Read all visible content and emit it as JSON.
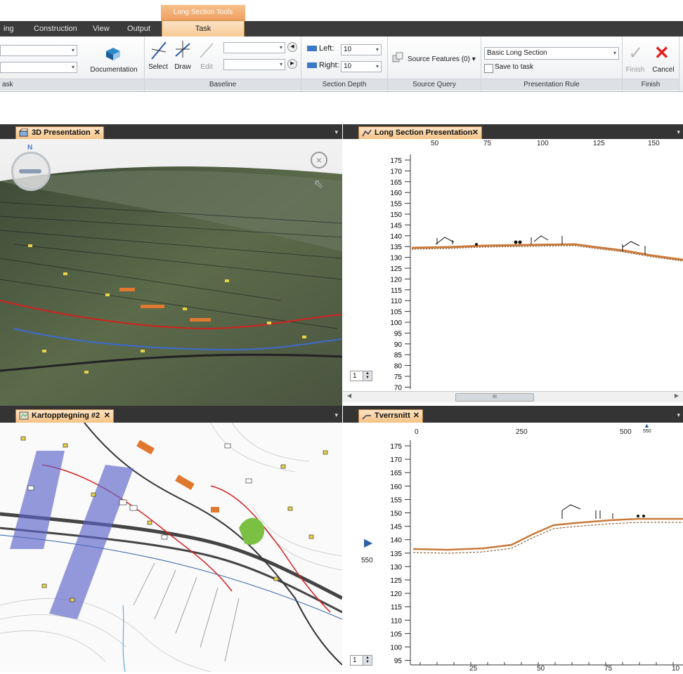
{
  "ribbon": {
    "context_tab": "Long Section Tools",
    "menu_items": [
      "ing",
      "Construction",
      "View",
      "Output"
    ],
    "active_tab": "Task",
    "task_group": {
      "label": "ask",
      "doc_button": "Documentation"
    },
    "baseline_group": {
      "label": "Baseline",
      "select": "Select",
      "draw": "Draw",
      "edit": "Edit"
    },
    "section_depth": {
      "label": "Section Depth",
      "left_label": "Left:",
      "left_value": "10",
      "right_label": "Right:",
      "right_value": "10"
    },
    "source_query": {
      "label": "Source Query",
      "button": "Source Features (0)"
    },
    "presentation_rule": {
      "label": "Presentation Rule",
      "combo_value": "Basic Long Section",
      "save_label": "Save to task"
    },
    "finish_group": {
      "label": "Finish",
      "finish": "Finish",
      "cancel": "Cancel"
    }
  },
  "panels": {
    "presentation3d": {
      "title": "3D Presentation",
      "compass": "N"
    },
    "long_section": {
      "title": "Long Section Presentation",
      "ruler_labels": [
        "50",
        "75",
        "100",
        "125",
        "150"
      ],
      "y_labels": [
        "175",
        "170",
        "165",
        "160",
        "155",
        "150",
        "145",
        "140",
        "135",
        "130",
        "125",
        "120",
        "115",
        "110",
        "105",
        "100",
        "95",
        "90",
        "85",
        "80",
        "75",
        "70"
      ],
      "spinner_value": "1",
      "scrollbar_grip": "III"
    },
    "map": {
      "title": "Kartopptegning #2"
    },
    "tverrsnitt": {
      "title": "Tverrsnitt",
      "ruler_labels": [
        "0",
        "250",
        "500",
        "550"
      ],
      "y_labels": [
        "175",
        "170",
        "165",
        "160",
        "155",
        "150",
        "145",
        "140",
        "135",
        "130",
        "125",
        "120",
        "115",
        "110",
        "105",
        "100",
        "95"
      ],
      "station_label": "550",
      "bottom_labels": [
        "25",
        "50",
        "75",
        "10"
      ],
      "spinner_value": "1"
    }
  },
  "colors": {
    "accent": "#f4c283",
    "panel_bar": "#343434",
    "ground": "#c97a3a"
  }
}
